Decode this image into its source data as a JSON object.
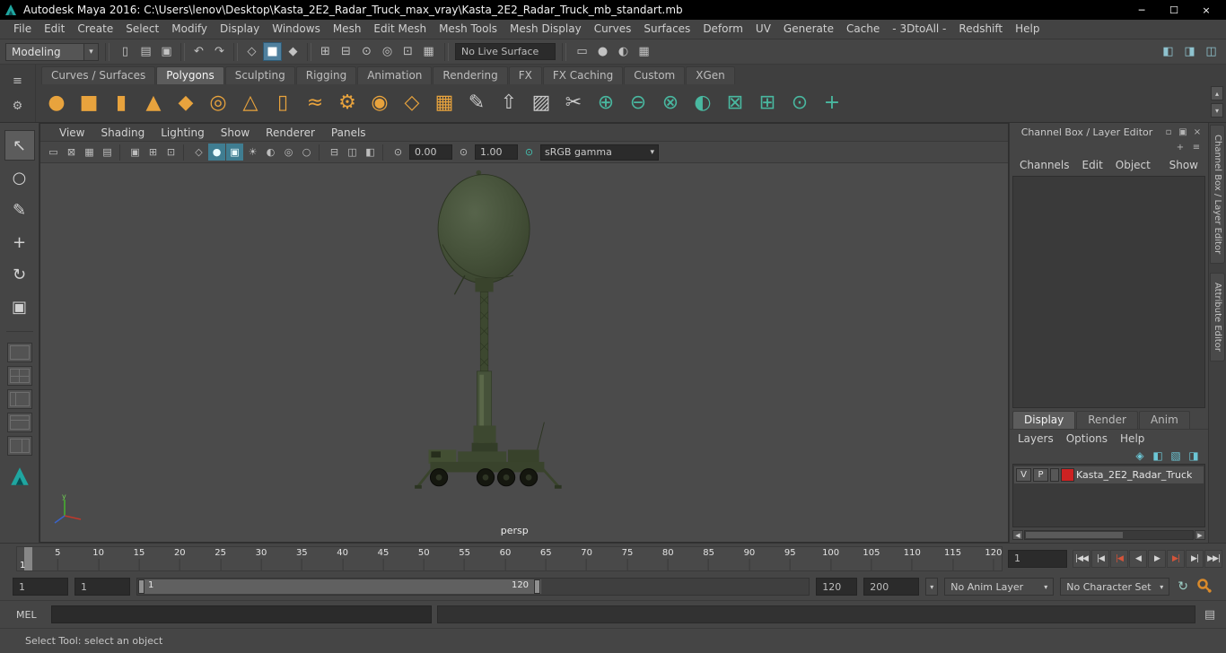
{
  "titlebar": {
    "title": "Autodesk Maya 2016: C:\\Users\\lenov\\Desktop\\Kasta_2E2_Radar_Truck_max_vray\\Kasta_2E2_Radar_Truck_mb_standart.mb",
    "window_buttons": {
      "minimize": "─",
      "maximize": "☐",
      "close": "×"
    }
  },
  "glyphs": {
    "caret_down": "▾",
    "caret_up": "▴",
    "left": "◀",
    "right": "▶",
    "script_editor": "▤",
    "playback_loop": "↻"
  },
  "menubar": {
    "items": [
      "File",
      "Edit",
      "Create",
      "Select",
      "Modify",
      "Display",
      "Windows",
      "Mesh",
      "Edit Mesh",
      "Mesh Tools",
      "Mesh Display",
      "Curves",
      "Surfaces",
      "Deform",
      "UV",
      "Generate",
      "Cache",
      "- 3DtoAll -",
      "Redshift",
      "Help"
    ]
  },
  "toolbar": {
    "mode_selector": "Modeling",
    "live_surface": "No Live Surface",
    "icon_groups": [
      [
        {
          "name": "new-scene-icon",
          "glyph": "▯"
        },
        {
          "name": "open-scene-icon",
          "glyph": "▤"
        },
        {
          "name": "save-scene-icon",
          "glyph": "▣"
        }
      ],
      [
        {
          "name": "undo-icon",
          "glyph": "↶"
        },
        {
          "name": "redo-icon",
          "glyph": "↷"
        }
      ],
      [
        {
          "name": "select-by-hierarchy-icon",
          "glyph": "◇"
        },
        {
          "name": "select-by-object-icon",
          "glyph": "■",
          "active": true
        },
        {
          "name": "select-by-component-icon",
          "glyph": "◆"
        }
      ],
      [
        {
          "name": "snap-to-grid-icon",
          "glyph": "⊞"
        },
        {
          "name": "snap-to-curve-icon",
          "glyph": "⊟"
        },
        {
          "name": "snap-to-point-icon",
          "glyph": "⊙"
        },
        {
          "name": "snap-projected-center-icon",
          "glyph": "◎"
        },
        {
          "name": "snap-view-plane-icon",
          "glyph": "⊡"
        },
        {
          "name": "make-live-icon",
          "glyph": "▦"
        }
      ]
    ],
    "render_icons": [
      {
        "name": "render-view-icon",
        "glyph": "▭"
      },
      {
        "name": "render-current-frame-icon",
        "glyph": "●"
      },
      {
        "name": "ipr-render-icon",
        "glyph": "◐"
      },
      {
        "name": "render-settings-icon",
        "glyph": "▦"
      }
    ],
    "right_icons": [
      {
        "name": "outliner-toggle-icon",
        "glyph": "◧"
      },
      {
        "name": "channel-box-toggle-icon",
        "glyph": "◨"
      },
      {
        "name": "workspace-toggle-icon",
        "glyph": "◫"
      }
    ]
  },
  "shelf": {
    "menu_icon": "≡",
    "options_icon": "⚙",
    "scroll_up_icon": "▴",
    "scroll_down_icon": "▾",
    "tabs": [
      "Curves / Surfaces",
      "Polygons",
      "Sculpting",
      "Rigging",
      "Animation",
      "Rendering",
      "FX",
      "FX Caching",
      "Custom",
      "XGen"
    ],
    "active_tab": "Polygons",
    "icons": [
      {
        "name": "poly-sphere-icon",
        "glyph": "●",
        "color": "#e8a33d"
      },
      {
        "name": "poly-cube-icon",
        "glyph": "■",
        "color": "#e8a33d"
      },
      {
        "name": "poly-cylinder-icon",
        "glyph": "▮",
        "color": "#e8a33d"
      },
      {
        "name": "poly-cone-icon",
        "glyph": "▲",
        "color": "#e8a33d"
      },
      {
        "name": "poly-plane-icon",
        "glyph": "◆",
        "color": "#e8a33d"
      },
      {
        "name": "poly-torus-icon",
        "glyph": "◎",
        "color": "#e8a33d"
      },
      {
        "name": "poly-pyramid-icon",
        "glyph": "△",
        "color": "#e8a33d"
      },
      {
        "name": "poly-pipe-icon",
        "glyph": "▯",
        "color": "#e8a33d"
      },
      {
        "name": "poly-helix-icon",
        "glyph": "≈",
        "color": "#e8a33d"
      },
      {
        "name": "poly-gear-icon",
        "glyph": "⚙",
        "color": "#e8a33d"
      },
      {
        "name": "poly-soccer-ball-icon",
        "glyph": "◉",
        "color": "#e8a33d"
      },
      {
        "name": "poly-platonic-solid-icon",
        "glyph": "◇",
        "color": "#e8a33d"
      },
      {
        "name": "poly-disc-icon",
        "glyph": "▦",
        "color": "#e8a33d"
      },
      {
        "name": "sculpt-tool-icon",
        "glyph": "✎",
        "color": "#c9c9c9"
      },
      {
        "name": "extrude-icon",
        "glyph": "⇧",
        "color": "#c9c9c9"
      },
      {
        "name": "bevel-icon",
        "glyph": "▨",
        "color": "#c9c9c9"
      },
      {
        "name": "multi-cut-icon",
        "glyph": "✂",
        "color": "#c9c9c9"
      },
      {
        "name": "boolean-union-icon",
        "glyph": "⊕",
        "color": "#49b8a0"
      },
      {
        "name": "boolean-difference-icon",
        "glyph": "⊖",
        "color": "#49b8a0"
      },
      {
        "name": "boolean-intersection-icon",
        "glyph": "⊗",
        "color": "#49b8a0"
      },
      {
        "name": "smooth-icon",
        "glyph": "◐",
        "color": "#49b8a0"
      },
      {
        "name": "mirror-icon",
        "glyph": "⊠",
        "color": "#49b8a0"
      },
      {
        "name": "quad-draw-icon",
        "glyph": "⊞",
        "color": "#49b8a0"
      },
      {
        "name": "target-weld-icon",
        "glyph": "⊙",
        "color": "#49b8a0"
      },
      {
        "name": "combine-icon",
        "glyph": "+",
        "color": "#49b8a0"
      }
    ]
  },
  "toolbox": {
    "tools": [
      {
        "name": "select-tool",
        "glyph": "↖",
        "active": true
      },
      {
        "name": "lasso-tool",
        "glyph": "○"
      },
      {
        "name": "paint-select-tool",
        "glyph": "✎"
      },
      {
        "name": "move-tool",
        "glyph": "+"
      },
      {
        "name": "rotate-tool",
        "glyph": "↻"
      },
      {
        "name": "scale-tool",
        "glyph": "▣"
      }
    ],
    "layouts": [
      {
        "name": "layout-single-pane",
        "kind": "single"
      },
      {
        "name": "layout-four-pane",
        "kind": "four"
      },
      {
        "name": "layout-persp-outliner",
        "kind": "split-v"
      },
      {
        "name": "layout-top-persp",
        "kind": "split-h"
      },
      {
        "name": "layout-persp-graph",
        "kind": "split-v2"
      }
    ]
  },
  "viewport": {
    "menu": [
      "View",
      "Shading",
      "Lighting",
      "Show",
      "Renderer",
      "Panels"
    ],
    "icon_groups": [
      [
        {
          "name": "select-camera-icon",
          "glyph": "▭"
        },
        {
          "name": "lock-camera-icon",
          "glyph": "⊠"
        },
        {
          "name": "camera-attributes-icon",
          "glyph": "▦"
        },
        {
          "name": "bookmarks-icon",
          "glyph": "▤"
        }
      ],
      [
        {
          "name": "image-plane-icon",
          "glyph": "▣"
        },
        {
          "name": "2d-pan-zoom-icon",
          "glyph": "⊞"
        },
        {
          "name": "overscan-icon",
          "glyph": "⊡"
        }
      ],
      [
        {
          "name": "wireframe-icon",
          "glyph": "◇"
        },
        {
          "name": "shaded-icon",
          "glyph": "●",
          "active": true
        },
        {
          "name": "textured-icon",
          "glyph": "▣",
          "active": true
        },
        {
          "name": "use-all-lights-icon",
          "glyph": "☀"
        },
        {
          "name": "shadows-icon",
          "glyph": "◐"
        },
        {
          "name": "screen-space-ao-icon",
          "glyph": "◎"
        },
        {
          "name": "motion-blur-icon",
          "glyph": "○"
        }
      ],
      [
        {
          "name": "isolate-select-icon",
          "glyph": "⊟"
        },
        {
          "name": "xray-icon",
          "glyph": "◫"
        },
        {
          "name": "backface-culling-icon",
          "glyph": "◧"
        }
      ],
      [
        {
          "name": "exposure-icon",
          "glyph": "⊙"
        }
      ]
    ],
    "exposure": "0.00",
    "gamma": "1.00",
    "gamma_icon": {
      "name": "gamma-icon",
      "glyph": "⊙"
    },
    "color_mgmt_icon": {
      "name": "color-management-icon",
      "glyph": "⊙"
    },
    "color_transform": "sRGB gamma",
    "camera_label": "persp"
  },
  "channel_box": {
    "header": "Channel Box / Layer Editor",
    "header_icons": [
      {
        "name": "dock-icon",
        "glyph": "▫"
      },
      {
        "name": "popout-icon",
        "glyph": "▣"
      },
      {
        "name": "close-panel-icon",
        "glyph": "×"
      }
    ],
    "tool_icons": [
      {
        "name": "add-key-icon",
        "glyph": "+"
      },
      {
        "name": "channel-display-icon",
        "glyph": "≡"
      }
    ],
    "menu": [
      "Channels",
      "Edit",
      "Object",
      "Show"
    ],
    "layer_tabs": [
      "Display",
      "Render",
      "Anim"
    ],
    "active_layer_tab": "Display",
    "layer_menu": [
      "Layers",
      "Options",
      "Help"
    ],
    "layer_icons": [
      {
        "name": "toggle-layer-mode-icon",
        "glyph": "◈"
      },
      {
        "name": "sync-layer-icon",
        "glyph": "◧"
      },
      {
        "name": "create-empty-layer-icon",
        "glyph": "▧"
      },
      {
        "name": "create-layer-from-selected-icon",
        "glyph": "◨"
      }
    ],
    "layer": {
      "visible": "V",
      "playback": "P",
      "name": "Kasta_2E2_Radar_Truck",
      "color": "#cc2222"
    }
  },
  "side_panel_tabs": [
    "Channel Box / Layer Editor",
    "Attribute Editor"
  ],
  "timeline": {
    "ticks": [
      5,
      10,
      15,
      20,
      25,
      30,
      35,
      40,
      45,
      50,
      55,
      60,
      65,
      70,
      75,
      80,
      85,
      90,
      95,
      100,
      105,
      110,
      115,
      120
    ],
    "current_frame": "1",
    "current_frame_field": "1",
    "playback": [
      {
        "name": "go-to-start-button",
        "glyph": "|◀◀"
      },
      {
        "name": "step-back-frame-button",
        "glyph": "|◀"
      },
      {
        "name": "step-back-key-button",
        "glyph": "|◀",
        "red": true
      },
      {
        "name": "play-backwards-button",
        "glyph": "◀"
      },
      {
        "name": "play-forwards-button",
        "glyph": "▶"
      },
      {
        "name": "step-forward-key-button",
        "glyph": "▶|",
        "red": true
      },
      {
        "name": "step-forward-frame-button",
        "glyph": "▶|"
      },
      {
        "name": "go-to-end-button",
        "glyph": "▶▶|"
      }
    ]
  },
  "range_slider": {
    "anim_start": "1",
    "play_start": "1",
    "bar_start": "1",
    "bar_end": "120",
    "play_end": "120",
    "anim_end": "200",
    "anim_layer": "No Anim Layer",
    "character_set": "No Character Set"
  },
  "command_line": {
    "label": "MEL",
    "input": "",
    "output": ""
  },
  "help_line": {
    "text": "Select Tool: select an object"
  }
}
